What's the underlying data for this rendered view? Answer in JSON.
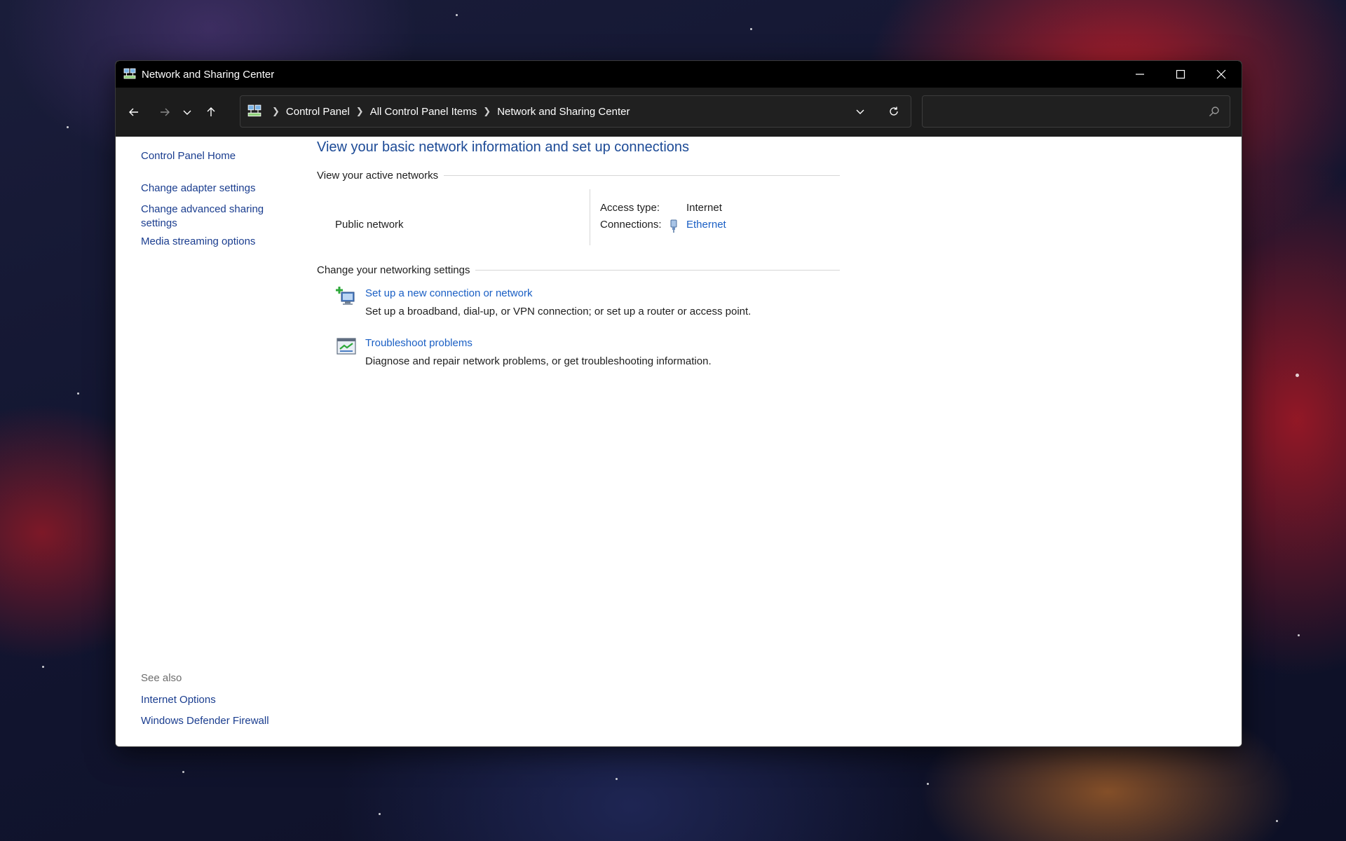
{
  "window": {
    "title": "Network and Sharing Center"
  },
  "address": {
    "crumbs": [
      "Control Panel",
      "All Control Panel Items",
      "Network and Sharing Center"
    ],
    "search_value": ""
  },
  "sidebar": {
    "links": [
      "Control Panel Home",
      "Change adapter settings",
      "Change advanced sharing settings",
      "Media streaming options"
    ],
    "see_also_label": "See also",
    "see_also_links": [
      "Internet Options",
      "Windows Defender Firewall"
    ]
  },
  "main": {
    "title": "View your basic network information and set up connections",
    "active_networks_heading": "View your active networks",
    "network": {
      "name": "Public network",
      "access_type_label": "Access type:",
      "access_type_value": "Internet",
      "connections_label": "Connections:",
      "connections_value": "Ethernet"
    },
    "settings_heading": "Change your networking settings",
    "tasks": [
      {
        "title": "Set up a new connection or network",
        "description": "Set up a broadband, dial-up, or VPN connection; or set up a router or access point."
      },
      {
        "title": "Troubleshoot problems",
        "description": "Diagnose and repair network problems, or get troubleshooting information."
      }
    ]
  },
  "colors": {
    "link": "#1a5fc4",
    "title": "#1c4a96",
    "titlebar": "#000000",
    "navbar": "#1c1c1c"
  }
}
